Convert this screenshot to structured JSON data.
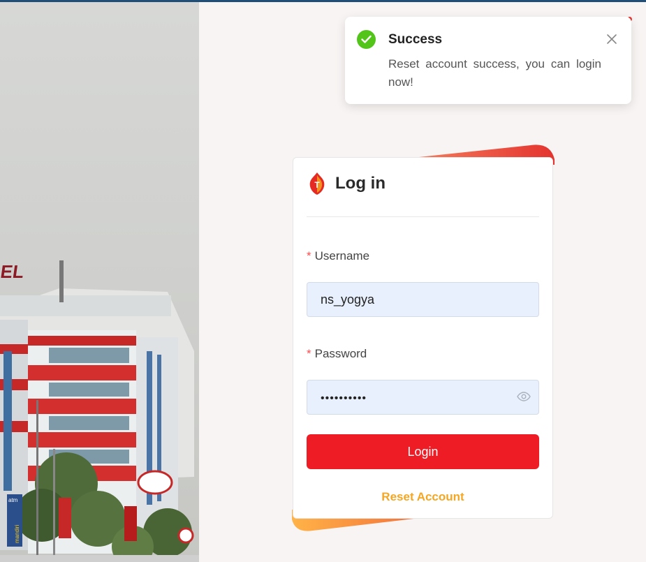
{
  "photo": {
    "building_sign": "OMSEL",
    "atm_sign": "atm",
    "bank_sign": "mandiri"
  },
  "toast": {
    "title": "Success",
    "message": "Reset account success, you can login now!",
    "icon": "check-circle-icon",
    "close_icon": "close-icon"
  },
  "login": {
    "title": "Log in",
    "logo_letter": "T",
    "username_label": "Username",
    "username_value": "ns_yogya",
    "password_label": "Password",
    "password_value": "••••••••••",
    "required_mark": "*",
    "login_button": "Login",
    "reset_link": "Reset Account"
  },
  "colors": {
    "accent_red": "#ee1c25",
    "link_orange": "#f5a623",
    "success_green": "#52c41a",
    "input_bg": "#e8f0fd"
  }
}
